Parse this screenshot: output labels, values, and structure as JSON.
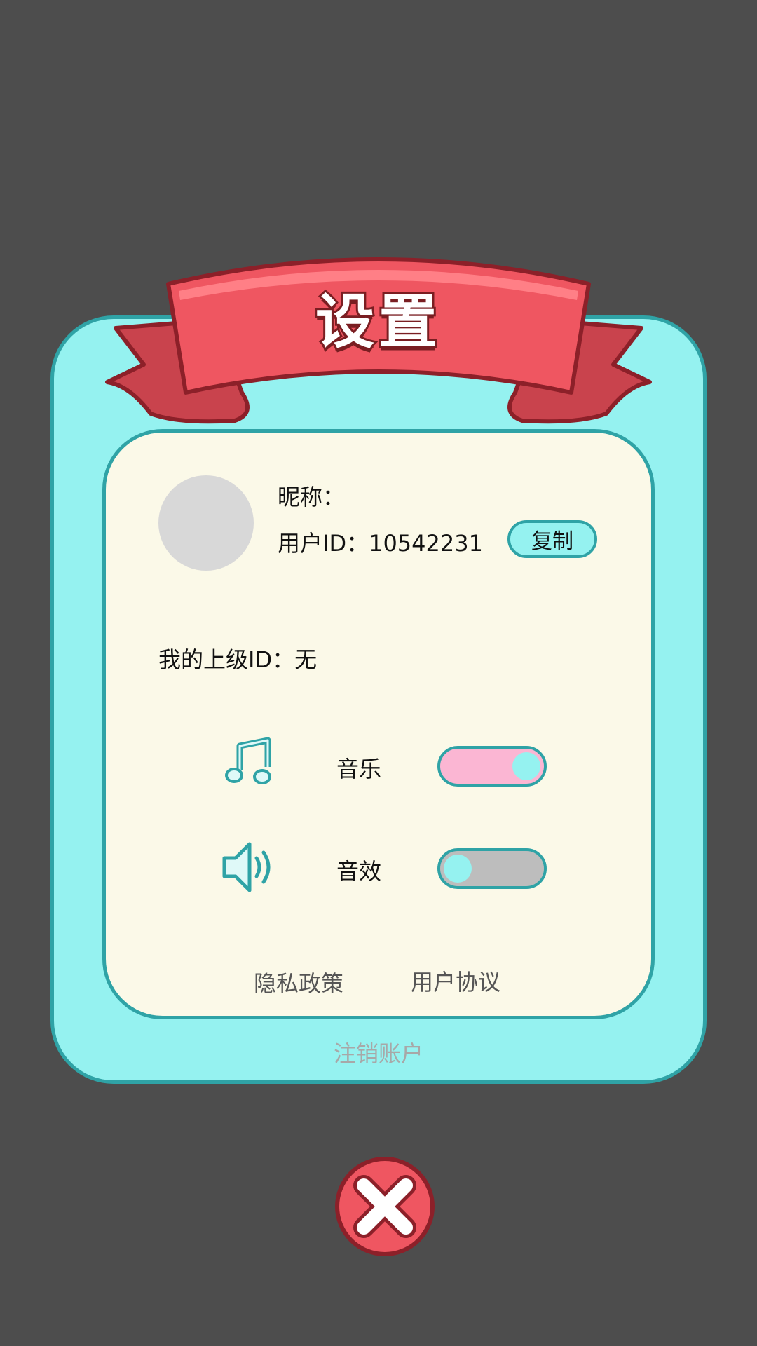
{
  "title": "设置",
  "profile": {
    "nickname_label": "昵称：",
    "user_id_label": "用户ID：10542231",
    "copy_button": "复制",
    "parent_id_label": "我的上级ID：无"
  },
  "settings": {
    "music_label": "音乐",
    "music_icon": "music-note-icon",
    "music_on": true,
    "sound_label": "音效",
    "sound_icon": "speaker-icon",
    "sound_on": false
  },
  "links": {
    "privacy": "隐私政策",
    "agreement": "用户协议"
  },
  "deactivate": "注销账户",
  "close_icon": "close-icon",
  "colors": {
    "background": "#4d4d4d",
    "panel": "#95f2f0",
    "panel_border": "#2fa3a6",
    "card": "#fbf9e8",
    "ribbon": "#ef5661",
    "toggle_on": "#fbb6d3",
    "toggle_off": "#bdbdbd"
  }
}
